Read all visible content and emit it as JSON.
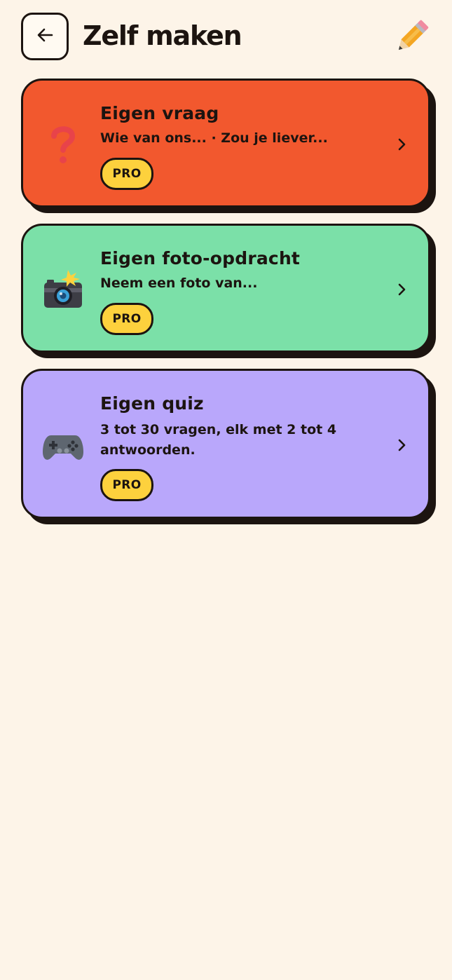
{
  "header": {
    "title": "Zelf maken",
    "back_icon": "arrow-left-icon",
    "action_icon": "pencil-icon"
  },
  "cards": [
    {
      "title": "Eigen vraag",
      "description": "Wie van ons... · Zou je liever...",
      "badge": "PRO",
      "icon": "question-mark-icon",
      "color": "#f2582e"
    },
    {
      "title": "Eigen foto-opdracht",
      "description": "Neem een foto van...",
      "badge": "PRO",
      "icon": "camera-flash-icon",
      "color": "#7be0a8"
    },
    {
      "title": "Eigen quiz",
      "description": "3 tot 30 vragen, elk met 2 tot 4 antwoorden.",
      "badge": "PRO",
      "icon": "game-controller-icon",
      "color": "#b9a7fb"
    }
  ],
  "colors": {
    "background": "#fdf4e8",
    "ink": "#1c1410",
    "badge": "#fdd13d"
  }
}
